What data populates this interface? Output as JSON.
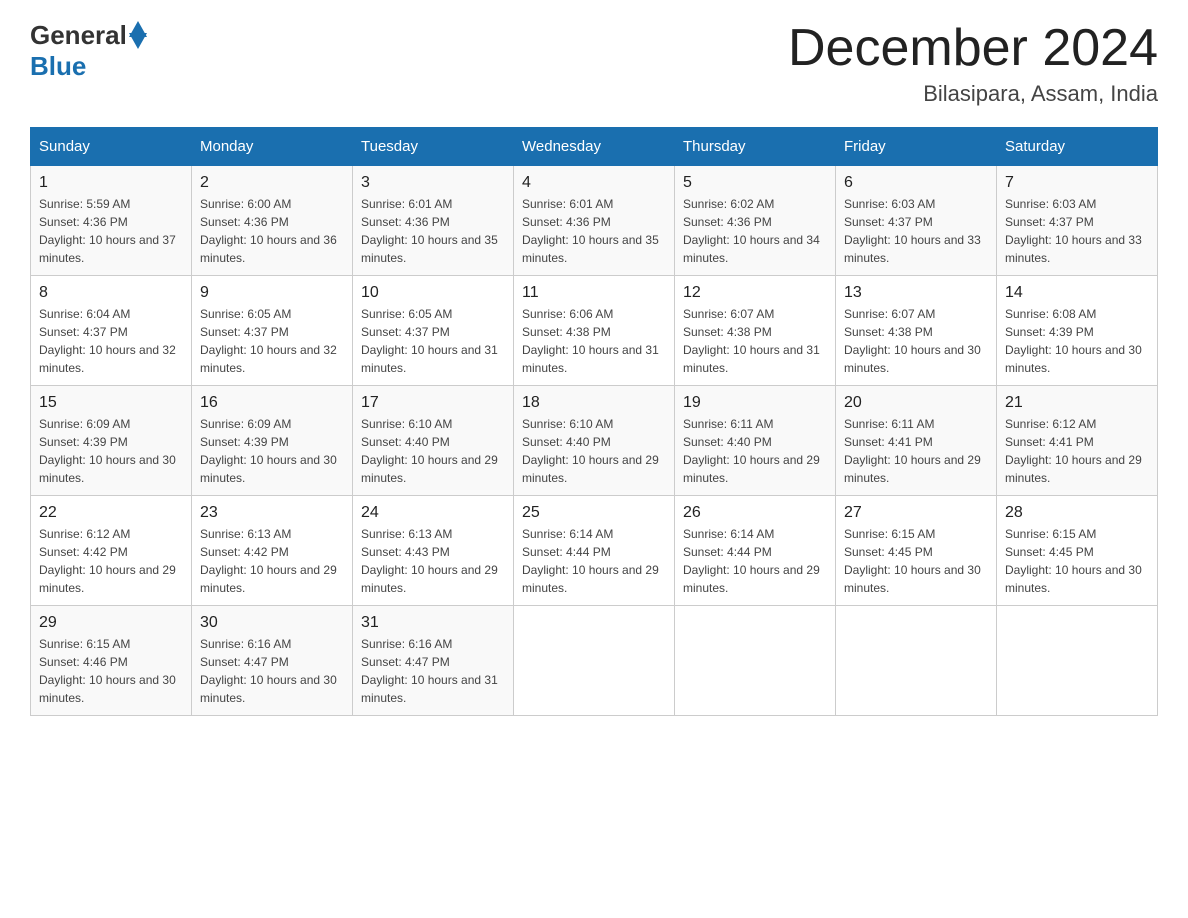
{
  "header": {
    "logo_general": "General",
    "logo_blue": "Blue",
    "month_title": "December 2024",
    "location": "Bilasipara, Assam, India"
  },
  "days_of_week": [
    "Sunday",
    "Monday",
    "Tuesday",
    "Wednesday",
    "Thursday",
    "Friday",
    "Saturday"
  ],
  "weeks": [
    [
      {
        "day": "1",
        "sunrise": "5:59 AM",
        "sunset": "4:36 PM",
        "daylight": "10 hours and 37 minutes."
      },
      {
        "day": "2",
        "sunrise": "6:00 AM",
        "sunset": "4:36 PM",
        "daylight": "10 hours and 36 minutes."
      },
      {
        "day": "3",
        "sunrise": "6:01 AM",
        "sunset": "4:36 PM",
        "daylight": "10 hours and 35 minutes."
      },
      {
        "day": "4",
        "sunrise": "6:01 AM",
        "sunset": "4:36 PM",
        "daylight": "10 hours and 35 minutes."
      },
      {
        "day": "5",
        "sunrise": "6:02 AM",
        "sunset": "4:36 PM",
        "daylight": "10 hours and 34 minutes."
      },
      {
        "day": "6",
        "sunrise": "6:03 AM",
        "sunset": "4:37 PM",
        "daylight": "10 hours and 33 minutes."
      },
      {
        "day": "7",
        "sunrise": "6:03 AM",
        "sunset": "4:37 PM",
        "daylight": "10 hours and 33 minutes."
      }
    ],
    [
      {
        "day": "8",
        "sunrise": "6:04 AM",
        "sunset": "4:37 PM",
        "daylight": "10 hours and 32 minutes."
      },
      {
        "day": "9",
        "sunrise": "6:05 AM",
        "sunset": "4:37 PM",
        "daylight": "10 hours and 32 minutes."
      },
      {
        "day": "10",
        "sunrise": "6:05 AM",
        "sunset": "4:37 PM",
        "daylight": "10 hours and 31 minutes."
      },
      {
        "day": "11",
        "sunrise": "6:06 AM",
        "sunset": "4:38 PM",
        "daylight": "10 hours and 31 minutes."
      },
      {
        "day": "12",
        "sunrise": "6:07 AM",
        "sunset": "4:38 PM",
        "daylight": "10 hours and 31 minutes."
      },
      {
        "day": "13",
        "sunrise": "6:07 AM",
        "sunset": "4:38 PM",
        "daylight": "10 hours and 30 minutes."
      },
      {
        "day": "14",
        "sunrise": "6:08 AM",
        "sunset": "4:39 PM",
        "daylight": "10 hours and 30 minutes."
      }
    ],
    [
      {
        "day": "15",
        "sunrise": "6:09 AM",
        "sunset": "4:39 PM",
        "daylight": "10 hours and 30 minutes."
      },
      {
        "day": "16",
        "sunrise": "6:09 AM",
        "sunset": "4:39 PM",
        "daylight": "10 hours and 30 minutes."
      },
      {
        "day": "17",
        "sunrise": "6:10 AM",
        "sunset": "4:40 PM",
        "daylight": "10 hours and 29 minutes."
      },
      {
        "day": "18",
        "sunrise": "6:10 AM",
        "sunset": "4:40 PM",
        "daylight": "10 hours and 29 minutes."
      },
      {
        "day": "19",
        "sunrise": "6:11 AM",
        "sunset": "4:40 PM",
        "daylight": "10 hours and 29 minutes."
      },
      {
        "day": "20",
        "sunrise": "6:11 AM",
        "sunset": "4:41 PM",
        "daylight": "10 hours and 29 minutes."
      },
      {
        "day": "21",
        "sunrise": "6:12 AM",
        "sunset": "4:41 PM",
        "daylight": "10 hours and 29 minutes."
      }
    ],
    [
      {
        "day": "22",
        "sunrise": "6:12 AM",
        "sunset": "4:42 PM",
        "daylight": "10 hours and 29 minutes."
      },
      {
        "day": "23",
        "sunrise": "6:13 AM",
        "sunset": "4:42 PM",
        "daylight": "10 hours and 29 minutes."
      },
      {
        "day": "24",
        "sunrise": "6:13 AM",
        "sunset": "4:43 PM",
        "daylight": "10 hours and 29 minutes."
      },
      {
        "day": "25",
        "sunrise": "6:14 AM",
        "sunset": "4:44 PM",
        "daylight": "10 hours and 29 minutes."
      },
      {
        "day": "26",
        "sunrise": "6:14 AM",
        "sunset": "4:44 PM",
        "daylight": "10 hours and 29 minutes."
      },
      {
        "day": "27",
        "sunrise": "6:15 AM",
        "sunset": "4:45 PM",
        "daylight": "10 hours and 30 minutes."
      },
      {
        "day": "28",
        "sunrise": "6:15 AM",
        "sunset": "4:45 PM",
        "daylight": "10 hours and 30 minutes."
      }
    ],
    [
      {
        "day": "29",
        "sunrise": "6:15 AM",
        "sunset": "4:46 PM",
        "daylight": "10 hours and 30 minutes."
      },
      {
        "day": "30",
        "sunrise": "6:16 AM",
        "sunset": "4:47 PM",
        "daylight": "10 hours and 30 minutes."
      },
      {
        "day": "31",
        "sunrise": "6:16 AM",
        "sunset": "4:47 PM",
        "daylight": "10 hours and 31 minutes."
      },
      null,
      null,
      null,
      null
    ]
  ]
}
